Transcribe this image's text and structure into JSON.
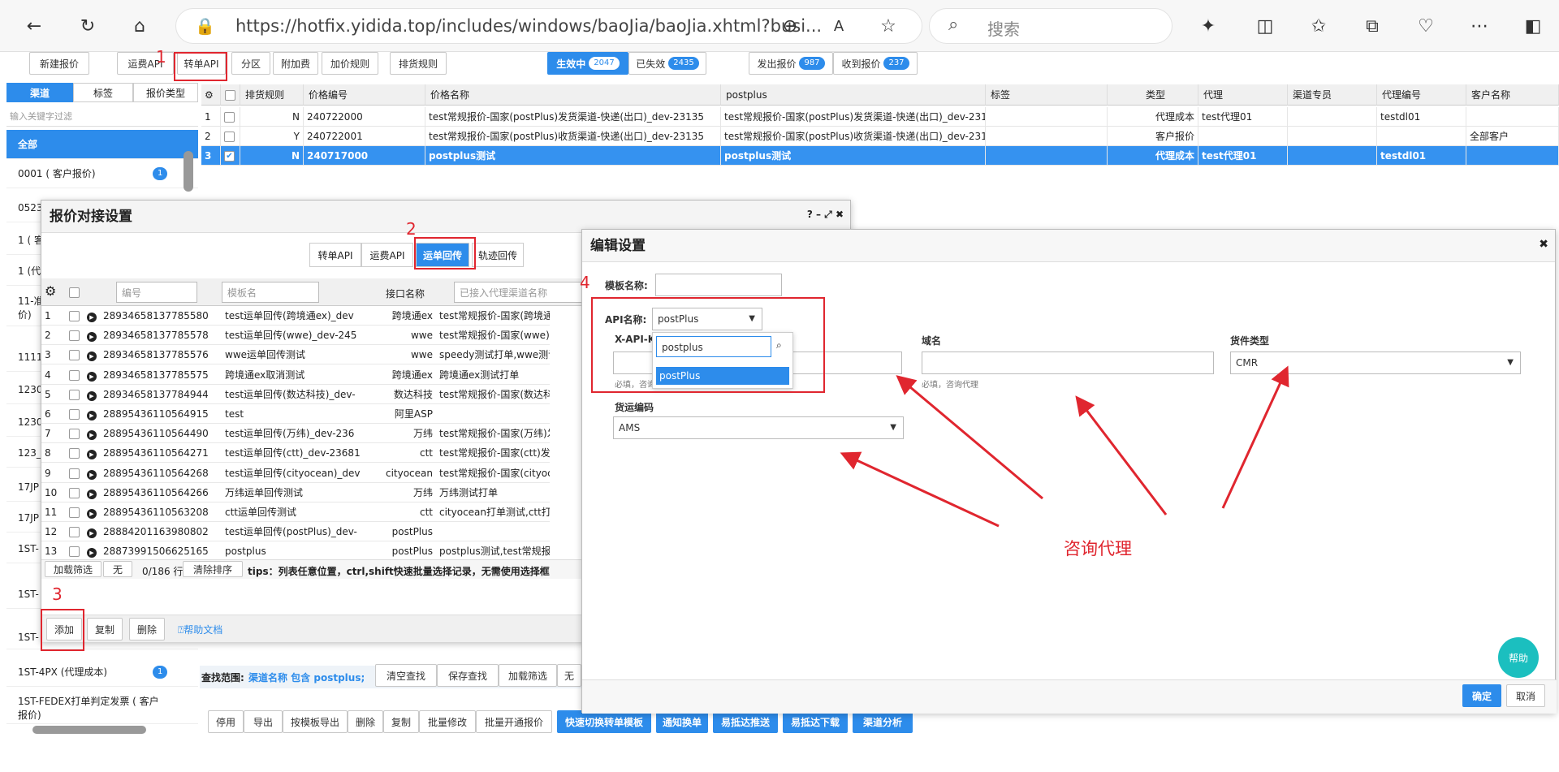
{
  "browser": {
    "url": "https://hotfix.yidida.top/includes/windows/baoJia/baoJia.xhtml?busi...",
    "search_placeholder": "搜索"
  },
  "toolbar": {
    "new_quote": "新建报价",
    "waybill_api": "运费API",
    "order_api": "转单API",
    "zone": "分区",
    "surcharge": "附加费",
    "markup_rule": "加价规则",
    "shipping_rule": "排货规则",
    "active": "生效中",
    "active_count": "2047",
    "expired": "已失效",
    "expired_count": "2435",
    "sent": "发出报价",
    "sent_count": "987",
    "received": "收到报价",
    "received_count": "237"
  },
  "annotations": {
    "n1": "1",
    "n2": "2",
    "n3": "3",
    "n4": "4",
    "consult": "咨询代理"
  },
  "left_panel": {
    "tabs": [
      "渠道",
      "标签",
      "报价类型"
    ],
    "filter_placeholder": "输入关键字过滤",
    "items": [
      {
        "label": "全部",
        "badge": ""
      },
      {
        "label": "0001 ( 客户报价)",
        "badge": "1"
      },
      {
        "label": "0523",
        "badge": ""
      },
      {
        "label": "1 ( 客",
        "badge": ""
      },
      {
        "label": "1 (代",
        "badge": ""
      },
      {
        "label": "11-准\n价)",
        "badge": ""
      },
      {
        "label": "1111",
        "badge": ""
      },
      {
        "label": "1230",
        "badge": ""
      },
      {
        "label": "1230",
        "badge": ""
      },
      {
        "label": "123_",
        "badge": ""
      },
      {
        "label": "17JP",
        "badge": ""
      },
      {
        "label": "17JP",
        "badge": ""
      },
      {
        "label": "1ST-",
        "badge": ""
      },
      {
        "label": "1ST-",
        "badge": ""
      },
      {
        "label": "1ST-",
        "badge": ""
      },
      {
        "label": "1ST-4PX (代理成本)",
        "badge": "1"
      },
      {
        "label": "1ST-FEDEX打单判定发票 ( 客户\n报价)",
        "badge": ""
      }
    ]
  },
  "main_grid": {
    "headers": [
      "排货规则",
      "价格编号",
      "价格名称",
      "postplus",
      "标签",
      "类型",
      "代理",
      "渠道专员",
      "代理编号",
      "客户名称"
    ],
    "rows": [
      {
        "n": "1",
        "rule": "N",
        "code": "240722000",
        "name": "test常规报价-国家(postPlus)发货渠道-快递(出口)_dev-23135",
        "pp": "test常规报价-国家(postPlus)发货渠道-快递(出口)_dev-23135",
        "type": "代理成本",
        "agent": "test代理01",
        "agentno": "testdl01",
        "customer": ""
      },
      {
        "n": "2",
        "rule": "Y",
        "code": "240722001",
        "name": "test常规报价-国家(postPlus)收货渠道-快递(出口)_dev-23135",
        "pp": "test常规报价-国家(postPlus)收货渠道-快递(出口)_dev-23135",
        "type": "客户报价",
        "agent": "",
        "agentno": "",
        "customer": "全部客户"
      },
      {
        "n": "3",
        "rule": "N",
        "code": "240717000",
        "name": "postplus测试",
        "pp": "postplus测试",
        "type": "代理成本",
        "agent": "test代理01",
        "agentno": "testdl01",
        "customer": ""
      }
    ]
  },
  "bottom": {
    "find_label": "查找范围:",
    "find_value": "渠道名称 包含 postplus;",
    "clear": "清空查找",
    "save": "保存查找",
    "filter": "加载筛选",
    "none": "无",
    "actions": [
      "停用",
      "导出",
      "按模板导出",
      "删除",
      "复制",
      "批量修改",
      "批量开通报价"
    ],
    "blue_actions": [
      "快速切换转单模板",
      "通知换单",
      "易抵达推送",
      "易抵达下载",
      "渠道分析"
    ]
  },
  "dialog1": {
    "title": "报价对接设置",
    "tabs": [
      "转单API",
      "运费API",
      "运单回传",
      "轨迹回传"
    ],
    "col_code": "编号",
    "col_tpl": "模板名",
    "col_api": "接口名称",
    "col_chan": "已接入代理渠道名称",
    "rows": [
      {
        "n": "1",
        "code": "28934658137785580",
        "tpl": "test运单回传(跨境通ex)_dev",
        "api": "跨境通ex",
        "chan": "test常规报价-国家(跨境通ex)发"
      },
      {
        "n": "2",
        "code": "28934658137785578",
        "tpl": "test运单回传(wwe)_dev-245",
        "api": "wwe",
        "chan": "test常规报价-国家(wwe)发货"
      },
      {
        "n": "3",
        "code": "28934658137785576",
        "tpl": "wwe运单回传测试",
        "api": "wwe",
        "chan": "speedy测试打单,wwe测试打单"
      },
      {
        "n": "4",
        "code": "28934658137785575",
        "tpl": "跨境通ex取消测试",
        "api": "跨境通ex",
        "chan": "跨境通ex测试打单"
      },
      {
        "n": "5",
        "code": "28934658137784944",
        "tpl": "test运单回传(数达科技)_dev-",
        "api": "数达科技",
        "chan": "test常规报价-国家(数达科技)"
      },
      {
        "n": "6",
        "code": "28895436110564915",
        "tpl": "test",
        "api": "阿里ASP",
        "chan": ""
      },
      {
        "n": "7",
        "code": "28895436110564490",
        "tpl": "test运单回传(万纬)_dev-236",
        "api": "万纬",
        "chan": "test常规报价-国家(万纬)发货"
      },
      {
        "n": "8",
        "code": "28895436110564271",
        "tpl": "test运单回传(ctt)_dev-23681",
        "api": "ctt",
        "chan": "test常规报价-国家(ctt)发货渠道"
      },
      {
        "n": "9",
        "code": "28895436110564268",
        "tpl": "test运单回传(cityocean)_dev",
        "api": "cityocean",
        "chan": "test常规报价-国家(cityocean)"
      },
      {
        "n": "10",
        "code": "28895436110564266",
        "tpl": "万纬运单回传测试",
        "api": "万纬",
        "chan": "万纬测试打单"
      },
      {
        "n": "11",
        "code": "28895436110563208",
        "tpl": "ctt运单回传测试",
        "api": "ctt",
        "chan": "cityocean打单测试,ctt打单测试"
      },
      {
        "n": "12",
        "code": "28884201163980802",
        "tpl": "test运单回传(postPlus)_dev-",
        "api": "postPlus",
        "chan": ""
      },
      {
        "n": "13",
        "code": "28873991506625165",
        "tpl": "postplus",
        "api": "postPlus",
        "chan": "postplus测试,test常规报价-国"
      }
    ],
    "pager_filter": "加载筛选",
    "pager_none": "无",
    "pager_count": "0/186 行",
    "clear_sort": "清除排序",
    "tips": "tips：列表任意位置，ctrl,shift快速批量选择记录，无需使用选择框",
    "add": "添加",
    "copy": "复制",
    "delete": "删除",
    "help": "帮助文档"
  },
  "dialog2": {
    "title": "编辑设置",
    "template_label": "模板名称:",
    "api_label": "API名称:",
    "api_value": "postPlus",
    "search_value": "postplus",
    "option": "postPlus",
    "xapi_label": "X-API-Ke",
    "domain_label": "域名",
    "cargo_label": "货件类型",
    "cargo_value": "CMR",
    "required_hint": "必填，咨询",
    "domain_hint": "必填，咨询代理",
    "port_label": "货运编码",
    "port_value": "AMS",
    "help": "帮助",
    "ok": "确定",
    "cancel": "取消"
  }
}
